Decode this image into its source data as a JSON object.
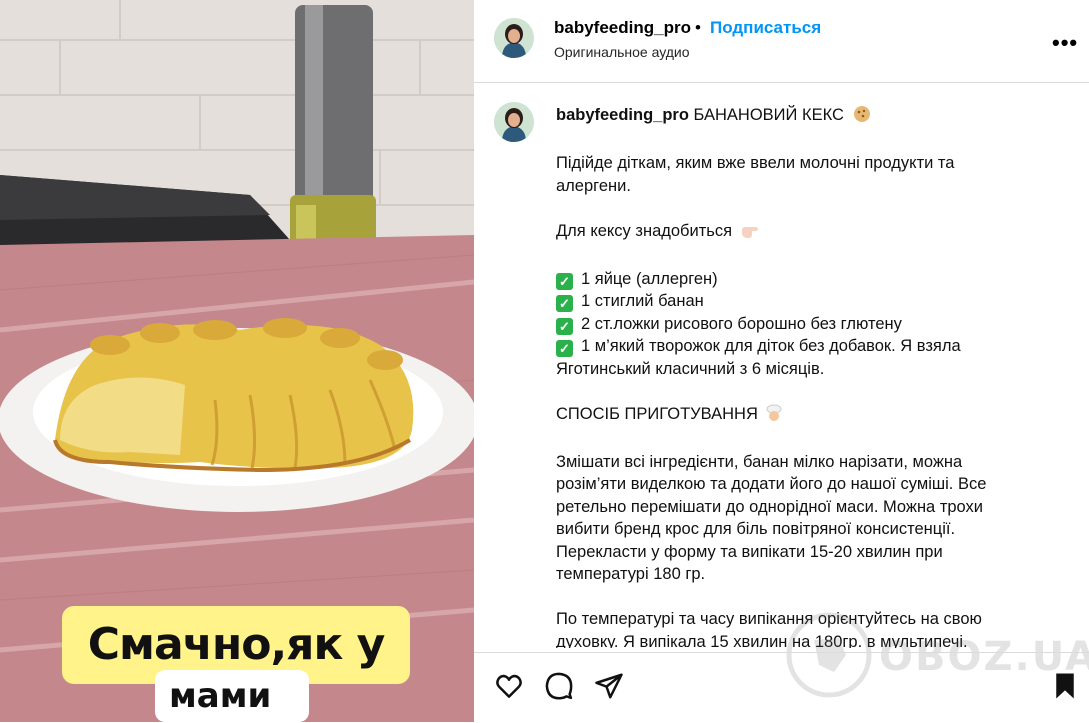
{
  "header": {
    "username": "babyfeeding_pro",
    "separator": "•",
    "follow_label": "Подписаться",
    "audio_label": "Оригинальное аудио",
    "more_label": "•••"
  },
  "caption": {
    "username": "babyfeeding_pro",
    "title": "БАНАНОВИЙ КЕКС",
    "lines": [
      "Підійде діткам, яким вже ввели молочні продукти та",
      "алергени.",
      "Для кексу знадобиться",
      "1 яйце (аллерген)",
      "1 стиглий банан",
      "2 ст.ложки рисового борошно без глютену",
      "1 м’який творожок для діток без добавок. Я взяла",
      "Яготинський класичний з 6 місяців.",
      "СПОСІБ ПРИГОТУВАННЯ",
      "Змішати всі інгредієнти, банан мілко нарізати, можна",
      "розім’яти виделкою та додати його до нашої суміші. Все",
      "ретельно перемішати до однорідної маси. Можна трохи",
      "вибити бренд крос для біль повітряної консистенції.",
      "Перекласти у форму та випікати 15-20 хвилин при",
      "температурі 180 гр.",
      "По температурі та часу випікання орієнтуйтесь на свою",
      "духовку. Я випікала 15 хвилин на 180гр. в мультипечі."
    ],
    "check_mark": "✓"
  },
  "media": {
    "sticker_line1": "Смачно,як у",
    "sticker_line2": "мами🥰"
  },
  "actions": {
    "icons": [
      "heart-icon",
      "comment-icon",
      "share-icon",
      "bookmark-icon"
    ]
  },
  "watermark": {
    "text": "OBOZ.UA"
  },
  "colors": {
    "follow": "#0095f6",
    "divider": "#dbdbdb",
    "check_bg": "#2bb14c",
    "sticker_yellow": "#fff38a"
  }
}
